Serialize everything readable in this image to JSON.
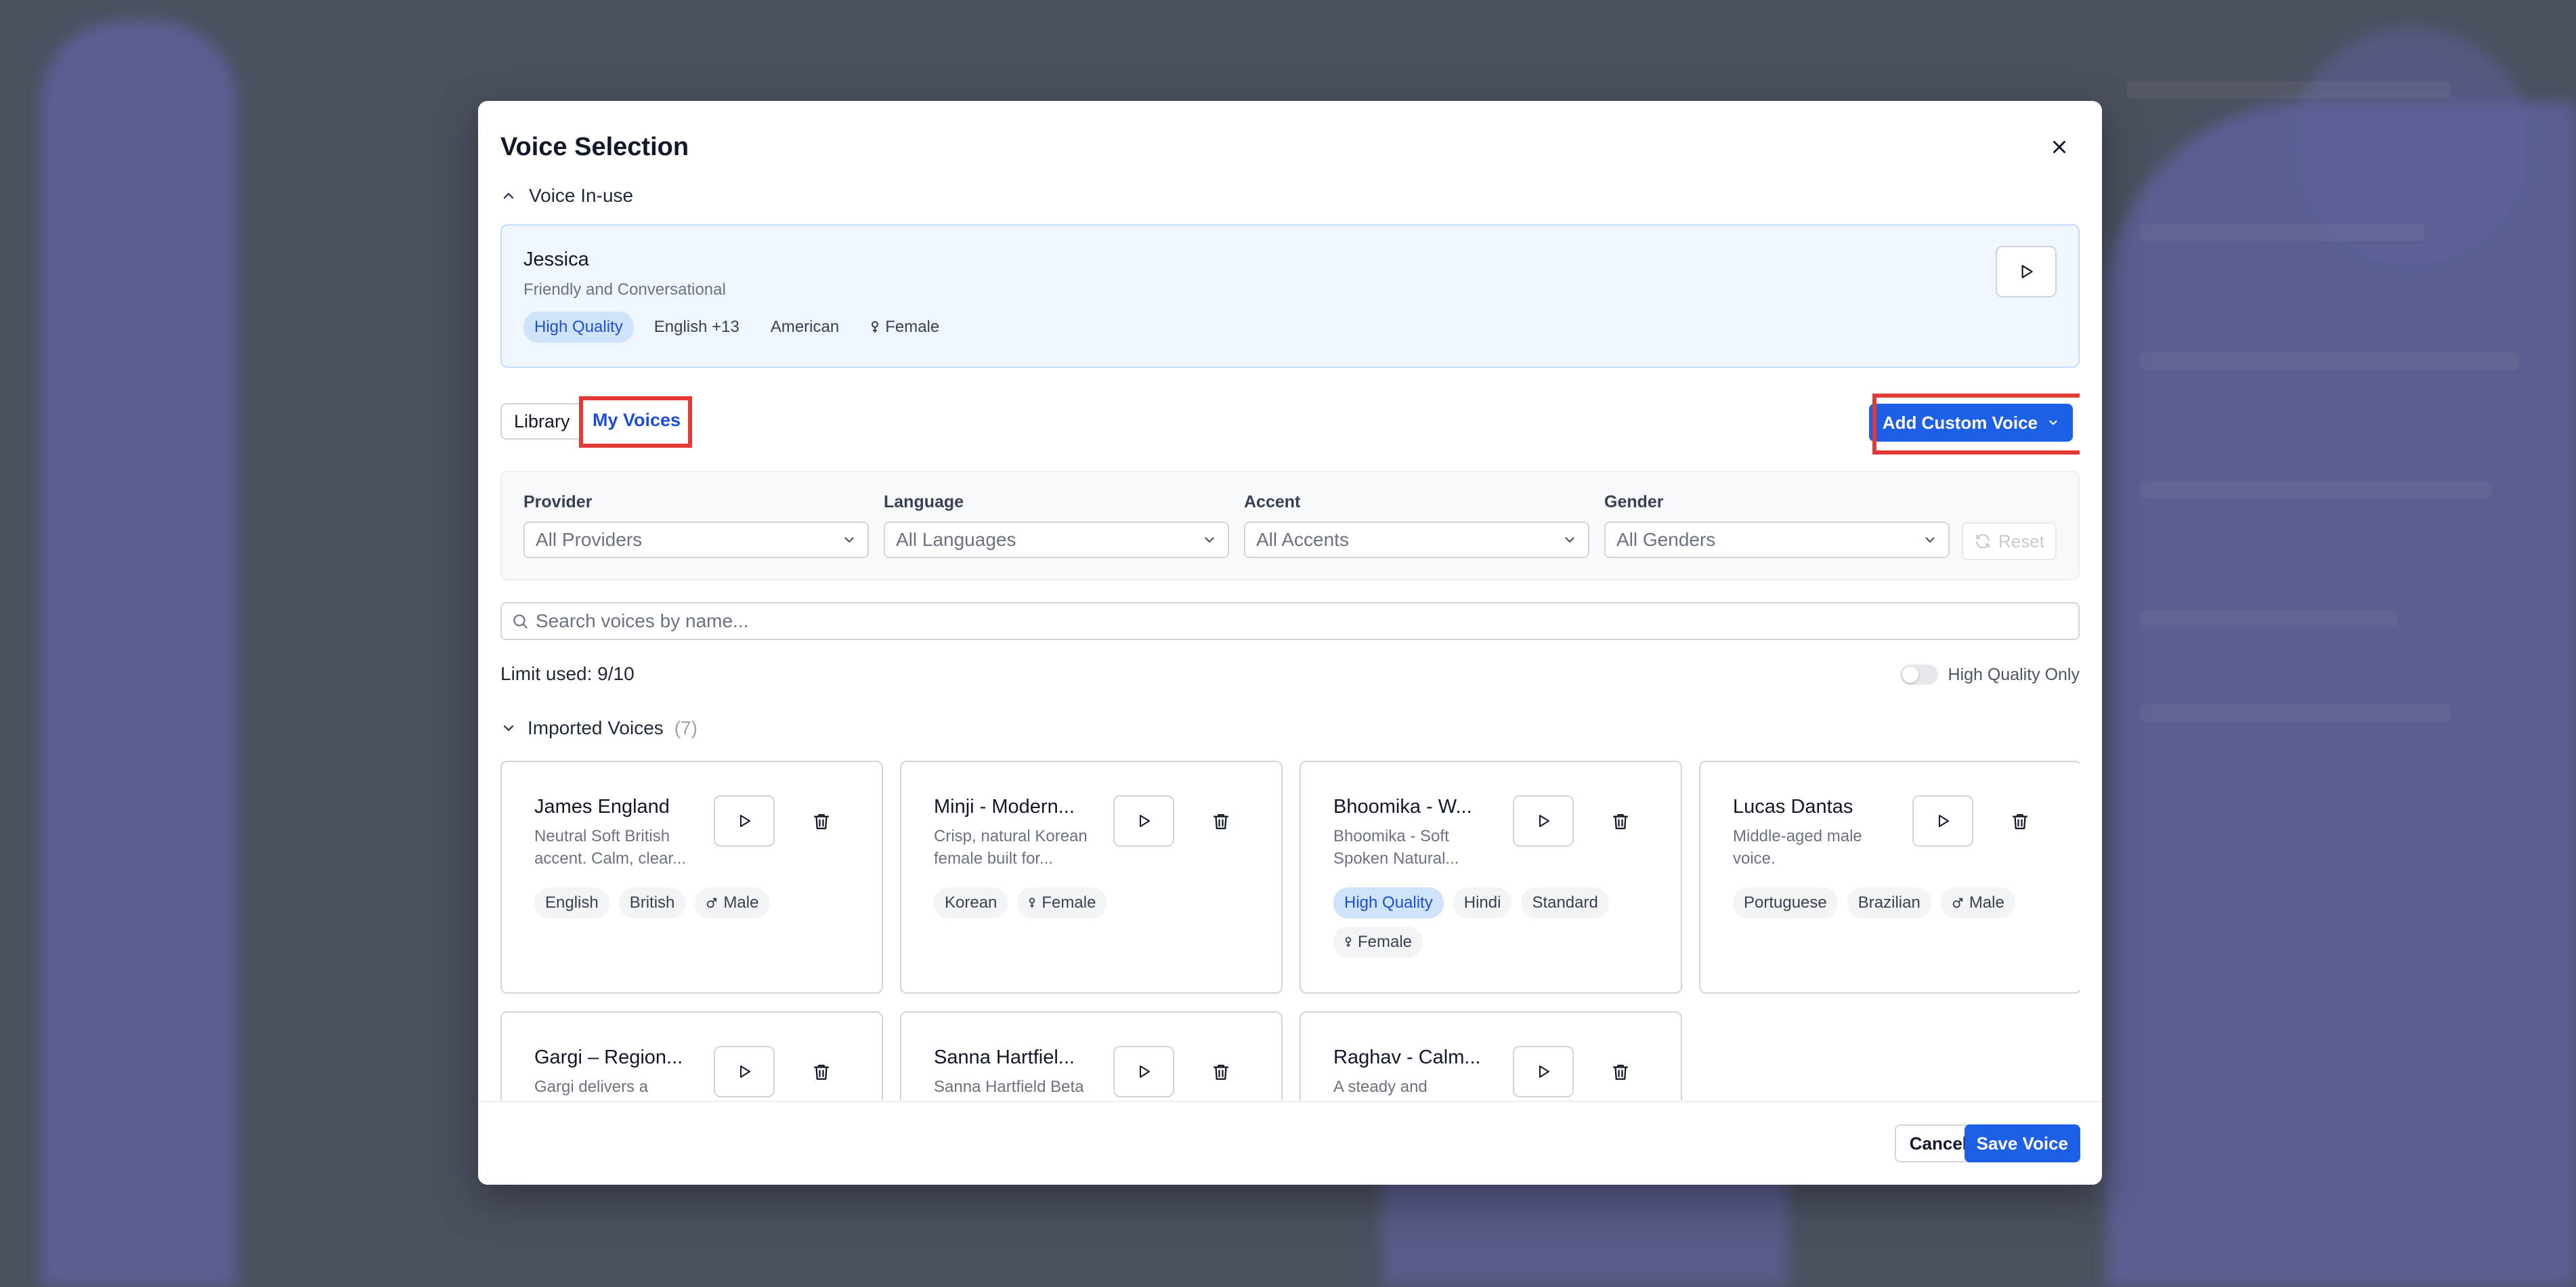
{
  "modal": {
    "title": "Voice Selection"
  },
  "voice_in_use": {
    "section_label": "Voice In-use",
    "name": "Jessica",
    "description": "Friendly and Conversational",
    "tags": {
      "quality": "High Quality",
      "language": "English +13",
      "accent": "American",
      "gender": "Female"
    }
  },
  "tabs": {
    "library": "Library",
    "my_voices": "My Voices",
    "active": "My Voices"
  },
  "add_custom_voice": "Add Custom Voice",
  "filters": {
    "provider": {
      "label": "Provider",
      "value": "All Providers"
    },
    "language": {
      "label": "Language",
      "value": "All Languages"
    },
    "accent": {
      "label": "Accent",
      "value": "All Accents"
    },
    "gender": {
      "label": "Gender",
      "value": "All Genders"
    },
    "reset": "Reset"
  },
  "search": {
    "placeholder": "Search voices by name..."
  },
  "limit": "Limit used: 9/10",
  "hq_toggle": {
    "label": "High Quality Only",
    "checked": false
  },
  "imported": {
    "title": "Imported Voices",
    "count": "(7)"
  },
  "cards": [
    {
      "name": "James England",
      "desc1": "Neutral Soft British",
      "desc2": "accent. Calm, clear...",
      "tags": [
        "English",
        "British",
        "Male"
      ]
    },
    {
      "name": "Minji - Modern...",
      "desc1": "Crisp, natural Korean",
      "desc2": "female built for...",
      "tags": [
        "Korean",
        "Female"
      ]
    },
    {
      "name": "Bhoomika - W...",
      "desc1": "Bhoomika - Soft",
      "desc2": "Spoken Natural...",
      "tags": [
        "High Quality",
        "Hindi",
        "Standard",
        "Female"
      ]
    },
    {
      "name": "Lucas Dantas",
      "desc1": "Middle-aged male",
      "desc2": "voice.",
      "tags": [
        "Portuguese",
        "Brazilian",
        "Male"
      ]
    },
    {
      "name": "Gargi – Region...",
      "desc1": "Gargi delivers a",
      "desc2": ""
    },
    {
      "name": "Sanna Hartfiel...",
      "desc1": "Sanna Hartfield Beta",
      "desc2": ""
    },
    {
      "name": "Raghav - Calm...",
      "desc1": "A steady and",
      "desc2": ""
    }
  ],
  "footer": {
    "cancel": "Cancel",
    "save": "Save Voice"
  },
  "colors": {
    "primary": "#1d5fe6",
    "highlight": "#e53935",
    "hq_tag_bg": "#cfe3fb"
  }
}
